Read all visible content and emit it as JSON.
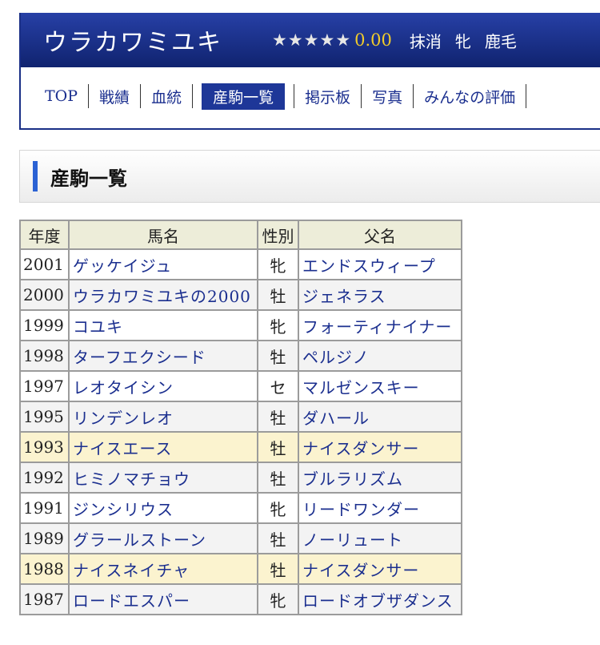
{
  "header": {
    "horse_name": "ウラカワミユキ",
    "stars": [
      "★",
      "★",
      "★",
      "★",
      "★"
    ],
    "rating": "0.00",
    "status": "抹消",
    "sex": "牝",
    "color": "鹿毛",
    "accent_color": "#1a2f86"
  },
  "tabs": [
    {
      "label": "TOP",
      "active": false
    },
    {
      "label": "戦績",
      "active": false
    },
    {
      "label": "血統",
      "active": false
    },
    {
      "label": "産駒一覧",
      "active": true
    },
    {
      "label": "掲示板",
      "active": false
    },
    {
      "label": "写真",
      "active": false
    },
    {
      "label": "みんなの評価",
      "active": false
    }
  ],
  "section": {
    "title": "産駒一覧"
  },
  "table": {
    "headers": [
      "年度",
      "馬名",
      "性別",
      "父名"
    ],
    "rows": [
      {
        "year": "2001",
        "name": "ゲッケイジュ",
        "sex": "牝",
        "sire": "エンドスウィープ",
        "style": "odd"
      },
      {
        "year": "2000",
        "name": "ウラカワミユキの2000",
        "sex": "牡",
        "sire": "ジェネラス",
        "style": "even"
      },
      {
        "year": "1999",
        "name": "コユキ",
        "sex": "牝",
        "sire": "フォーティナイナー",
        "style": "odd"
      },
      {
        "year": "1998",
        "name": "ターフエクシード",
        "sex": "牡",
        "sire": "ペルジノ",
        "style": "even"
      },
      {
        "year": "1997",
        "name": "レオタイシン",
        "sex": "セ",
        "sire": "マルゼンスキー",
        "style": "odd"
      },
      {
        "year": "1995",
        "name": "リンデンレオ",
        "sex": "牡",
        "sire": "ダハール",
        "style": "even"
      },
      {
        "year": "1993",
        "name": "ナイスエース",
        "sex": "牡",
        "sire": "ナイスダンサー",
        "style": "hl"
      },
      {
        "year": "1992",
        "name": "ヒミノマチョウ",
        "sex": "牡",
        "sire": "ブルラリズム",
        "style": "even"
      },
      {
        "year": "1991",
        "name": "ジンシリウス",
        "sex": "牝",
        "sire": "リードワンダー",
        "style": "odd"
      },
      {
        "year": "1989",
        "name": "グラールストーン",
        "sex": "牡",
        "sire": "ノーリュート",
        "style": "even"
      },
      {
        "year": "1988",
        "name": "ナイスネイチャ",
        "sex": "牡",
        "sire": "ナイスダンサー",
        "style": "hl"
      },
      {
        "year": "1987",
        "name": "ロードエスパー",
        "sex": "牝",
        "sire": "ロードオブザダンス",
        "style": "even"
      }
    ]
  }
}
